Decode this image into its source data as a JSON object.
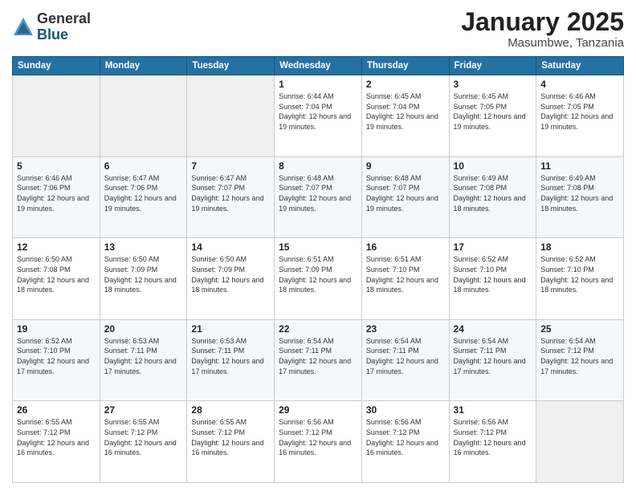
{
  "header": {
    "logo_general": "General",
    "logo_blue": "Blue",
    "month_title": "January 2025",
    "subtitle": "Masumbwe, Tanzania"
  },
  "days_of_week": [
    "Sunday",
    "Monday",
    "Tuesday",
    "Wednesday",
    "Thursday",
    "Friday",
    "Saturday"
  ],
  "weeks": [
    [
      {
        "day": "",
        "info": ""
      },
      {
        "day": "",
        "info": ""
      },
      {
        "day": "",
        "info": ""
      },
      {
        "day": "1",
        "info": "Sunrise: 6:44 AM\nSunset: 7:04 PM\nDaylight: 12 hours and 19 minutes."
      },
      {
        "day": "2",
        "info": "Sunrise: 6:45 AM\nSunset: 7:04 PM\nDaylight: 12 hours and 19 minutes."
      },
      {
        "day": "3",
        "info": "Sunrise: 6:45 AM\nSunset: 7:05 PM\nDaylight: 12 hours and 19 minutes."
      },
      {
        "day": "4",
        "info": "Sunrise: 6:46 AM\nSunset: 7:05 PM\nDaylight: 12 hours and 19 minutes."
      }
    ],
    [
      {
        "day": "5",
        "info": "Sunrise: 6:46 AM\nSunset: 7:06 PM\nDaylight: 12 hours and 19 minutes."
      },
      {
        "day": "6",
        "info": "Sunrise: 6:47 AM\nSunset: 7:06 PM\nDaylight: 12 hours and 19 minutes."
      },
      {
        "day": "7",
        "info": "Sunrise: 6:47 AM\nSunset: 7:07 PM\nDaylight: 12 hours and 19 minutes."
      },
      {
        "day": "8",
        "info": "Sunrise: 6:48 AM\nSunset: 7:07 PM\nDaylight: 12 hours and 19 minutes."
      },
      {
        "day": "9",
        "info": "Sunrise: 6:48 AM\nSunset: 7:07 PM\nDaylight: 12 hours and 19 minutes."
      },
      {
        "day": "10",
        "info": "Sunrise: 6:49 AM\nSunset: 7:08 PM\nDaylight: 12 hours and 18 minutes."
      },
      {
        "day": "11",
        "info": "Sunrise: 6:49 AM\nSunset: 7:08 PM\nDaylight: 12 hours and 18 minutes."
      }
    ],
    [
      {
        "day": "12",
        "info": "Sunrise: 6:50 AM\nSunset: 7:08 PM\nDaylight: 12 hours and 18 minutes."
      },
      {
        "day": "13",
        "info": "Sunrise: 6:50 AM\nSunset: 7:09 PM\nDaylight: 12 hours and 18 minutes."
      },
      {
        "day": "14",
        "info": "Sunrise: 6:50 AM\nSunset: 7:09 PM\nDaylight: 12 hours and 18 minutes."
      },
      {
        "day": "15",
        "info": "Sunrise: 6:51 AM\nSunset: 7:09 PM\nDaylight: 12 hours and 18 minutes."
      },
      {
        "day": "16",
        "info": "Sunrise: 6:51 AM\nSunset: 7:10 PM\nDaylight: 12 hours and 18 minutes."
      },
      {
        "day": "17",
        "info": "Sunrise: 6:52 AM\nSunset: 7:10 PM\nDaylight: 12 hours and 18 minutes."
      },
      {
        "day": "18",
        "info": "Sunrise: 6:52 AM\nSunset: 7:10 PM\nDaylight: 12 hours and 18 minutes."
      }
    ],
    [
      {
        "day": "19",
        "info": "Sunrise: 6:52 AM\nSunset: 7:10 PM\nDaylight: 12 hours and 17 minutes."
      },
      {
        "day": "20",
        "info": "Sunrise: 6:53 AM\nSunset: 7:11 PM\nDaylight: 12 hours and 17 minutes."
      },
      {
        "day": "21",
        "info": "Sunrise: 6:53 AM\nSunset: 7:11 PM\nDaylight: 12 hours and 17 minutes."
      },
      {
        "day": "22",
        "info": "Sunrise: 6:54 AM\nSunset: 7:11 PM\nDaylight: 12 hours and 17 minutes."
      },
      {
        "day": "23",
        "info": "Sunrise: 6:54 AM\nSunset: 7:11 PM\nDaylight: 12 hours and 17 minutes."
      },
      {
        "day": "24",
        "info": "Sunrise: 6:54 AM\nSunset: 7:11 PM\nDaylight: 12 hours and 17 minutes."
      },
      {
        "day": "25",
        "info": "Sunrise: 6:54 AM\nSunset: 7:12 PM\nDaylight: 12 hours and 17 minutes."
      }
    ],
    [
      {
        "day": "26",
        "info": "Sunrise: 6:55 AM\nSunset: 7:12 PM\nDaylight: 12 hours and 16 minutes."
      },
      {
        "day": "27",
        "info": "Sunrise: 6:55 AM\nSunset: 7:12 PM\nDaylight: 12 hours and 16 minutes."
      },
      {
        "day": "28",
        "info": "Sunrise: 6:55 AM\nSunset: 7:12 PM\nDaylight: 12 hours and 16 minutes."
      },
      {
        "day": "29",
        "info": "Sunrise: 6:56 AM\nSunset: 7:12 PM\nDaylight: 12 hours and 16 minutes."
      },
      {
        "day": "30",
        "info": "Sunrise: 6:56 AM\nSunset: 7:12 PM\nDaylight: 12 hours and 16 minutes."
      },
      {
        "day": "31",
        "info": "Sunrise: 6:56 AM\nSunset: 7:12 PM\nDaylight: 12 hours and 16 minutes."
      },
      {
        "day": "",
        "info": ""
      }
    ]
  ]
}
